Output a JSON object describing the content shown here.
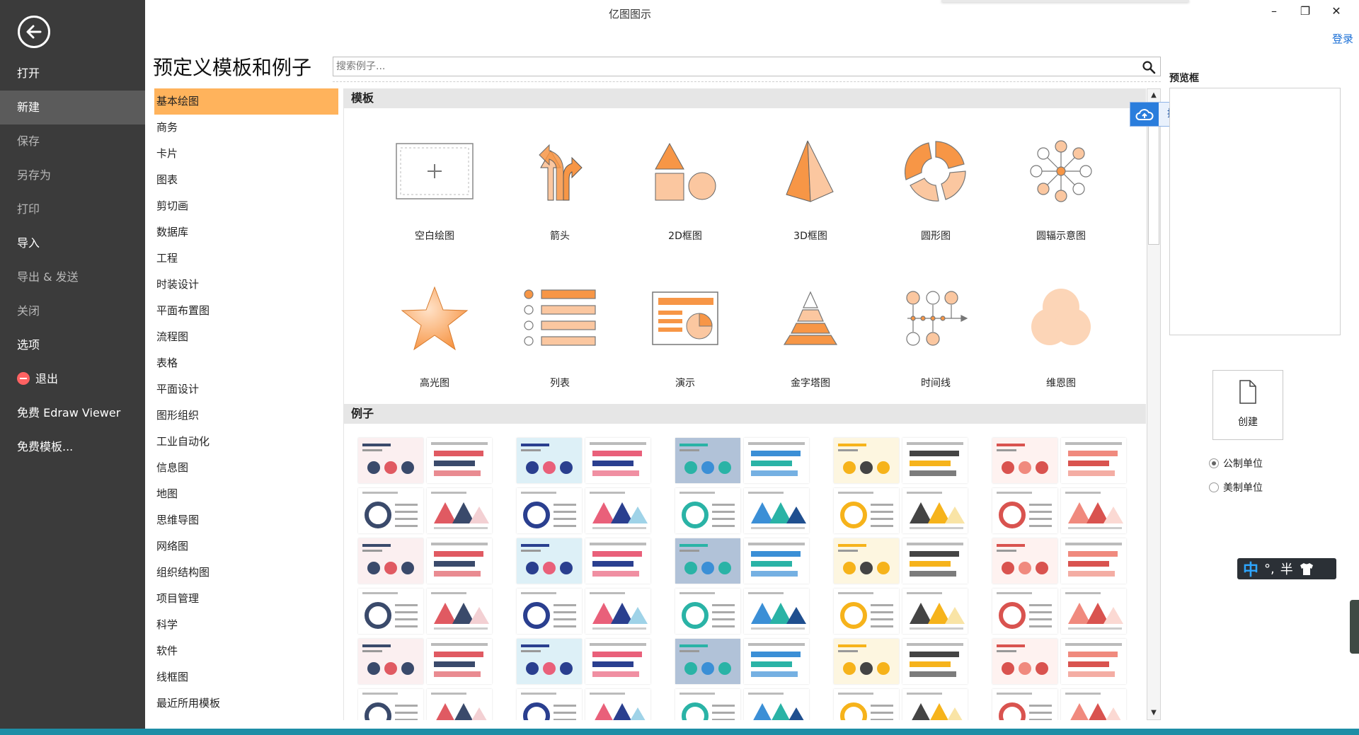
{
  "window": {
    "title": "亿图图示",
    "minimize": "–",
    "restore": "❐",
    "close": "✕",
    "login": "登录"
  },
  "left_menu": {
    "items": [
      {
        "label": "打开",
        "state": "normal"
      },
      {
        "label": "新建",
        "state": "active"
      },
      {
        "label": "保存",
        "state": "dim"
      },
      {
        "label": "另存为",
        "state": "dim"
      },
      {
        "label": "打印",
        "state": "dim"
      },
      {
        "label": "导入",
        "state": "normal"
      },
      {
        "label": "导出 & 发送",
        "state": "dim"
      },
      {
        "label": "关闭",
        "state": "dim"
      },
      {
        "label": "选项",
        "state": "normal"
      },
      {
        "label": "退出",
        "state": "normal"
      },
      {
        "label": "免费 Edraw Viewer",
        "state": "normal"
      },
      {
        "label": "免费模板...",
        "state": "normal"
      }
    ]
  },
  "main": {
    "title": "预定义模板和例子",
    "search_placeholder": "搜索例子...",
    "categories": [
      "基本绘图",
      "商务",
      "卡片",
      "图表",
      "剪切画",
      "数据库",
      "工程",
      "时装设计",
      "平面布置图",
      "流程图",
      "表格",
      "平面设计",
      "图形组织",
      "工业自动化",
      "信息图",
      "地图",
      "思维导图",
      "网络图",
      "组织结构图",
      "项目管理",
      "科学",
      "软件",
      "线框图",
      "最近所用模板"
    ],
    "selected_category": "基本绘图",
    "templates_header": "模板",
    "templates": [
      {
        "label": "空白绘图",
        "icon": "blank-drawing-icon"
      },
      {
        "label": "箭头",
        "icon": "arrows-icon"
      },
      {
        "label": "2D框图",
        "icon": "2d-block-icon"
      },
      {
        "label": "3D框图",
        "icon": "3d-block-icon"
      },
      {
        "label": "圆形图",
        "icon": "circle-diagram-icon"
      },
      {
        "label": "圆辐示意图",
        "icon": "spoke-diagram-icon"
      },
      {
        "label": "高光图",
        "icon": "star-icon"
      },
      {
        "label": "列表",
        "icon": "list-icon"
      },
      {
        "label": "演示",
        "icon": "presentation-icon"
      },
      {
        "label": "金字塔图",
        "icon": "pyramid-icon"
      },
      {
        "label": "时间线",
        "icon": "timeline-icon"
      },
      {
        "label": "维恩图",
        "icon": "venn-icon"
      }
    ],
    "examples_header": "例子",
    "upload_tip": "拖拽上传"
  },
  "right_panel": {
    "preview_title": "预览框",
    "create_label": "创建",
    "units": [
      {
        "label": "公制单位",
        "checked": true
      },
      {
        "label": "美制单位",
        "checked": false
      }
    ]
  },
  "ime": {
    "lang": "中",
    "punct": "°,",
    "width": "半"
  },
  "colors": {
    "menu_bg": "#3b3b3b",
    "selected_category": "#ffb35c",
    "accent_orange": "#f79646",
    "light_orange": "#fbc7a0",
    "link_blue": "#1a6fd6",
    "taskbar": "#1e8ea6"
  }
}
